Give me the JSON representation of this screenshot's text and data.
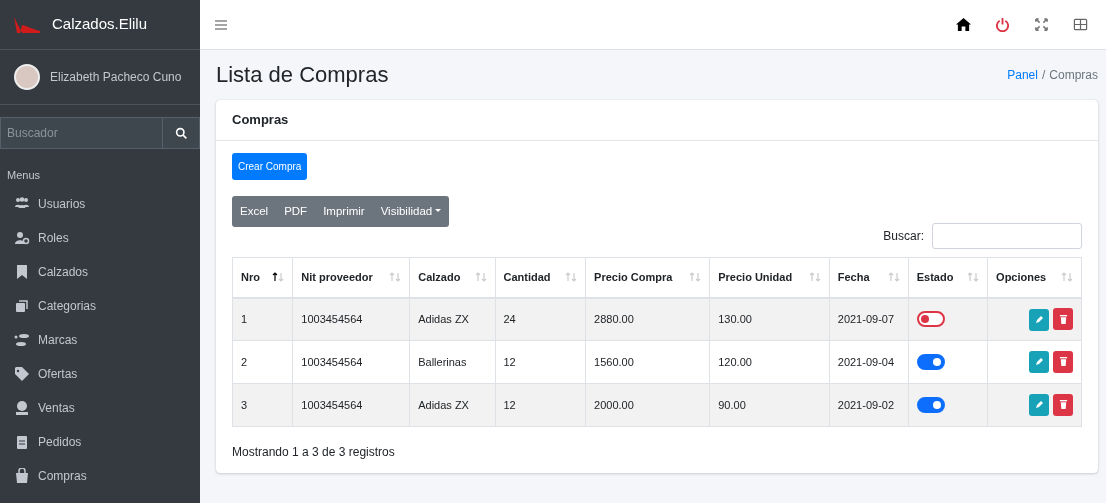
{
  "sidebar": {
    "brand": "Calzados.Elilu",
    "user": "Elizabeth Pacheco Cuno",
    "search": {
      "placeholder": "Buscador"
    },
    "header": "Menus",
    "items": [
      {
        "label": "Usuarios"
      },
      {
        "label": "Roles"
      },
      {
        "label": "Calzados"
      },
      {
        "label": "Categorias"
      },
      {
        "label": "Marcas"
      },
      {
        "label": "Ofertas"
      },
      {
        "label": "Ventas"
      },
      {
        "label": "Pedidos"
      },
      {
        "label": "Compras"
      }
    ]
  },
  "page": {
    "title": "Lista de Compras",
    "separator": "/",
    "breadcrumb": [
      {
        "label": "Panel",
        "link": true
      },
      {
        "label": "Compras",
        "link": false
      }
    ]
  },
  "card": {
    "title": "Compras",
    "create_button": "Crear Compra",
    "export_buttons": [
      {
        "label": "Excel",
        "kind": "plain"
      },
      {
        "label": "PDF",
        "kind": "plain"
      },
      {
        "label": "Imprimir",
        "kind": "plain"
      },
      {
        "label": "Visibilidad",
        "kind": "dropdown"
      }
    ],
    "search_label": "Buscar:",
    "columns": [
      {
        "label": "Nro",
        "sorted": true
      },
      {
        "label": "Nit proveedor",
        "sorted": false
      },
      {
        "label": "Calzado",
        "sorted": false
      },
      {
        "label": "Cantidad",
        "sorted": false
      },
      {
        "label": "Precio Compra",
        "sorted": false
      },
      {
        "label": "Precio Unidad",
        "sorted": false
      },
      {
        "label": "Fecha",
        "sorted": false
      },
      {
        "label": "Estado",
        "sorted": false
      },
      {
        "label": "Opciones",
        "sorted": false
      }
    ],
    "rows": [
      {
        "cells": [
          "1",
          "1003454564",
          "Adidas ZX",
          "24",
          "2880.00",
          "130.00",
          "2021-09-07"
        ],
        "on": false
      },
      {
        "cells": [
          "2",
          "1003454564",
          "Ballerinas",
          "12",
          "1560.00",
          "120.00",
          "2021-09-04"
        ],
        "on": true
      },
      {
        "cells": [
          "3",
          "1003454564",
          "Adidas ZX",
          "12",
          "2000.00",
          "90.00",
          "2021-09-02"
        ],
        "on": true
      }
    ],
    "footer": "Mostrando 1 a 3 de 3 registros"
  }
}
